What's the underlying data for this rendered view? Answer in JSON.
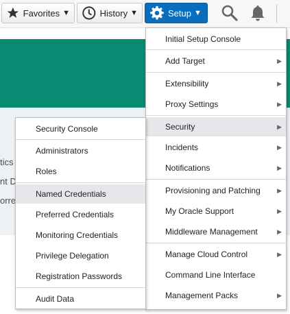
{
  "toolbar": {
    "favorites_label": "Favorites",
    "history_label": "History",
    "setup_label": "Setup",
    "accent_color": "#0a6ebd"
  },
  "background_text": [
    "tics",
    "nt D",
    "orre"
  ],
  "setup_menu": {
    "items": [
      {
        "label": "Initial Setup Console"
      },
      {
        "label": "Add Target"
      },
      {
        "label": "Extensibility"
      },
      {
        "label": "Proxy Settings"
      },
      {
        "label": "Security"
      },
      {
        "label": "Incidents"
      },
      {
        "label": "Notifications"
      },
      {
        "label": "Provisioning and Patching"
      },
      {
        "label": "My Oracle Support"
      },
      {
        "label": "Middleware Management"
      },
      {
        "label": "Manage Cloud Control"
      },
      {
        "label": "Command Line Interface"
      },
      {
        "label": "Management Packs"
      }
    ]
  },
  "security_submenu": {
    "items": [
      {
        "label": "Security Console"
      },
      {
        "label": "Administrators"
      },
      {
        "label": "Roles"
      },
      {
        "label": "Named Credentials"
      },
      {
        "label": "Preferred Credentials"
      },
      {
        "label": "Monitoring Credentials"
      },
      {
        "label": "Privilege Delegation"
      },
      {
        "label": "Registration Passwords"
      },
      {
        "label": "Audit Data"
      }
    ]
  }
}
